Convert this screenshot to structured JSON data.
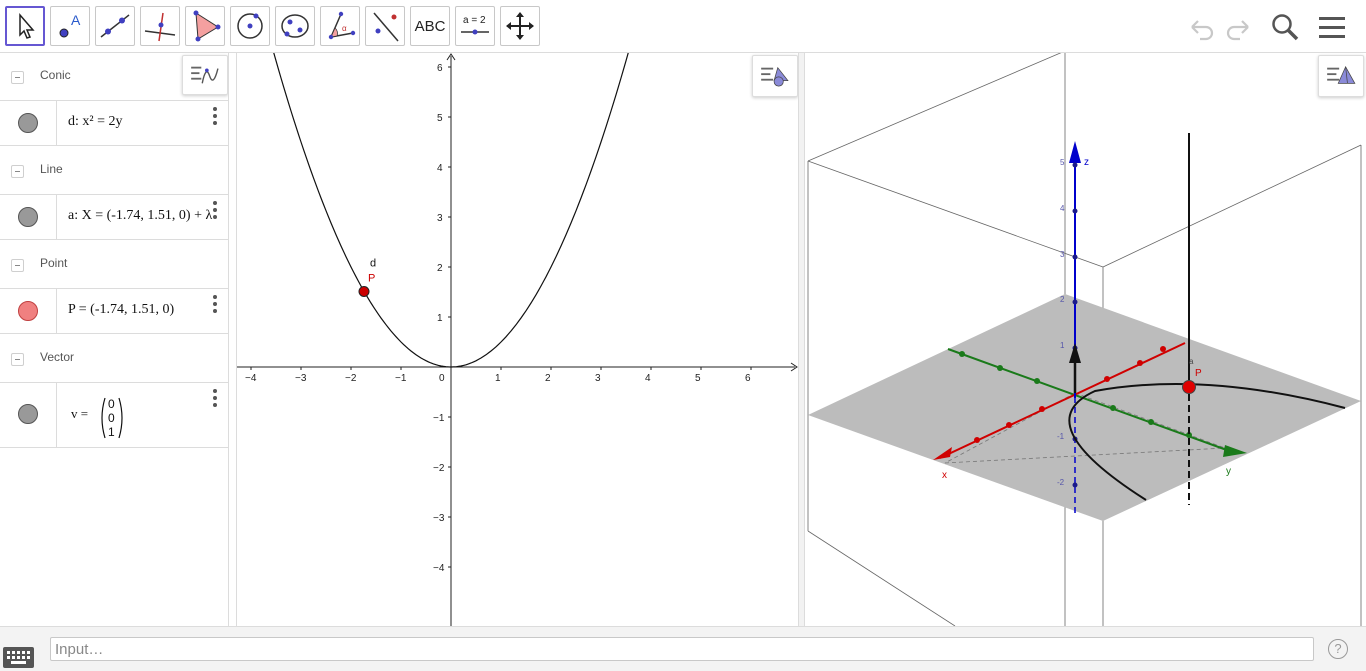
{
  "toolbar": {
    "text_tool_label": "ABC",
    "slider_tool_label": "a = 2"
  },
  "algebra": {
    "groups": [
      {
        "label": "Conic",
        "item": "d: x² = 2y",
        "marble_color": "#999999"
      },
      {
        "label": "Line",
        "item": "a: X = (-1.74, 1.51, 0) + λ",
        "marble_color": "#999999"
      },
      {
        "label": "Point",
        "item": "P = (-1.74, 1.51, 0)",
        "marble_color": "#f08080"
      },
      {
        "label": "Vector",
        "item_prefix": "v =",
        "vector": [
          "0",
          "0",
          "1"
        ],
        "marble_color": "#999999"
      }
    ]
  },
  "graphics2d": {
    "x_ticks": [
      "−4",
      "−3",
      "−2",
      "−1",
      "0",
      "1",
      "2",
      "3",
      "4",
      "5",
      "6"
    ],
    "y_ticks": [
      "6",
      "5",
      "4",
      "3",
      "2",
      "1",
      "−1",
      "−2",
      "−3",
      "−4"
    ],
    "curve_label": "d",
    "point_label": "P",
    "point": {
      "x": -1.74,
      "y": 1.51
    },
    "point_color": "#cc0000"
  },
  "graphics3d": {
    "z_ticks": [
      "5",
      "4",
      "3",
      "2",
      "1",
      "-1",
      "-2"
    ],
    "axis_labels": {
      "x": "x",
      "y": "y",
      "z": "z"
    },
    "point_label": "P",
    "line_label": "a",
    "colors": {
      "x_axis": "#d00000",
      "y_axis": "#1a7a1a",
      "z_axis": "#0000cc",
      "plane": "#bcbcbc"
    }
  },
  "input": {
    "placeholder": "Input…",
    "help_label": "?"
  }
}
